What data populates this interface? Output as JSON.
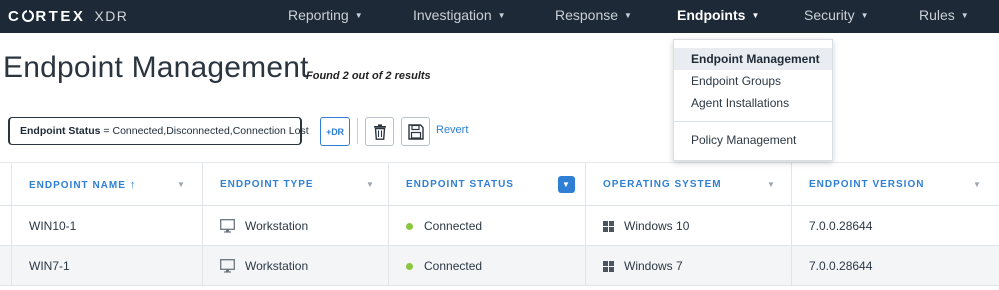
{
  "app": {
    "logo_main": "CRTEX",
    "logo_sub": "XDR"
  },
  "nav": {
    "items": [
      {
        "label": "Reporting"
      },
      {
        "label": "Investigation"
      },
      {
        "label": "Response"
      },
      {
        "label": "Endpoints"
      },
      {
        "label": "Security"
      },
      {
        "label": "Rules"
      }
    ],
    "active": "Endpoints"
  },
  "page": {
    "title": "Endpoint Management",
    "results": "Found 2 out of 2 results"
  },
  "filter": {
    "key": "Endpoint Status",
    "operator": "=",
    "value": "Connected,Disconnected,Connection Lost",
    "xdr_button": "+DR",
    "revert": "Revert"
  },
  "dropdown": {
    "items": [
      {
        "label": "Endpoint Management",
        "active": true
      },
      {
        "label": "Endpoint Groups"
      },
      {
        "label": "Agent Installations"
      },
      {
        "label": "Policy Management"
      }
    ]
  },
  "table": {
    "columns": [
      {
        "label": "ENDPOINT NAME",
        "sort": "ascending"
      },
      {
        "label": "ENDPOINT TYPE"
      },
      {
        "label": "ENDPOINT STATUS",
        "filter_active": true
      },
      {
        "label": "OPERATING SYSTEM"
      },
      {
        "label": "ENDPOINT VERSION"
      }
    ],
    "rows": [
      {
        "name": "WIN10-1",
        "type": "Workstation",
        "status": "Connected",
        "os": "Windows 10",
        "version": "7.0.0.28644"
      },
      {
        "name": "WIN7-1",
        "type": "Workstation",
        "status": "Connected",
        "os": "Windows 7",
        "version": "7.0.0.28644"
      }
    ]
  },
  "colors": {
    "nav_bg": "#1d2936",
    "accent": "#2f7fd4",
    "status_connected": "#8cc63f"
  }
}
